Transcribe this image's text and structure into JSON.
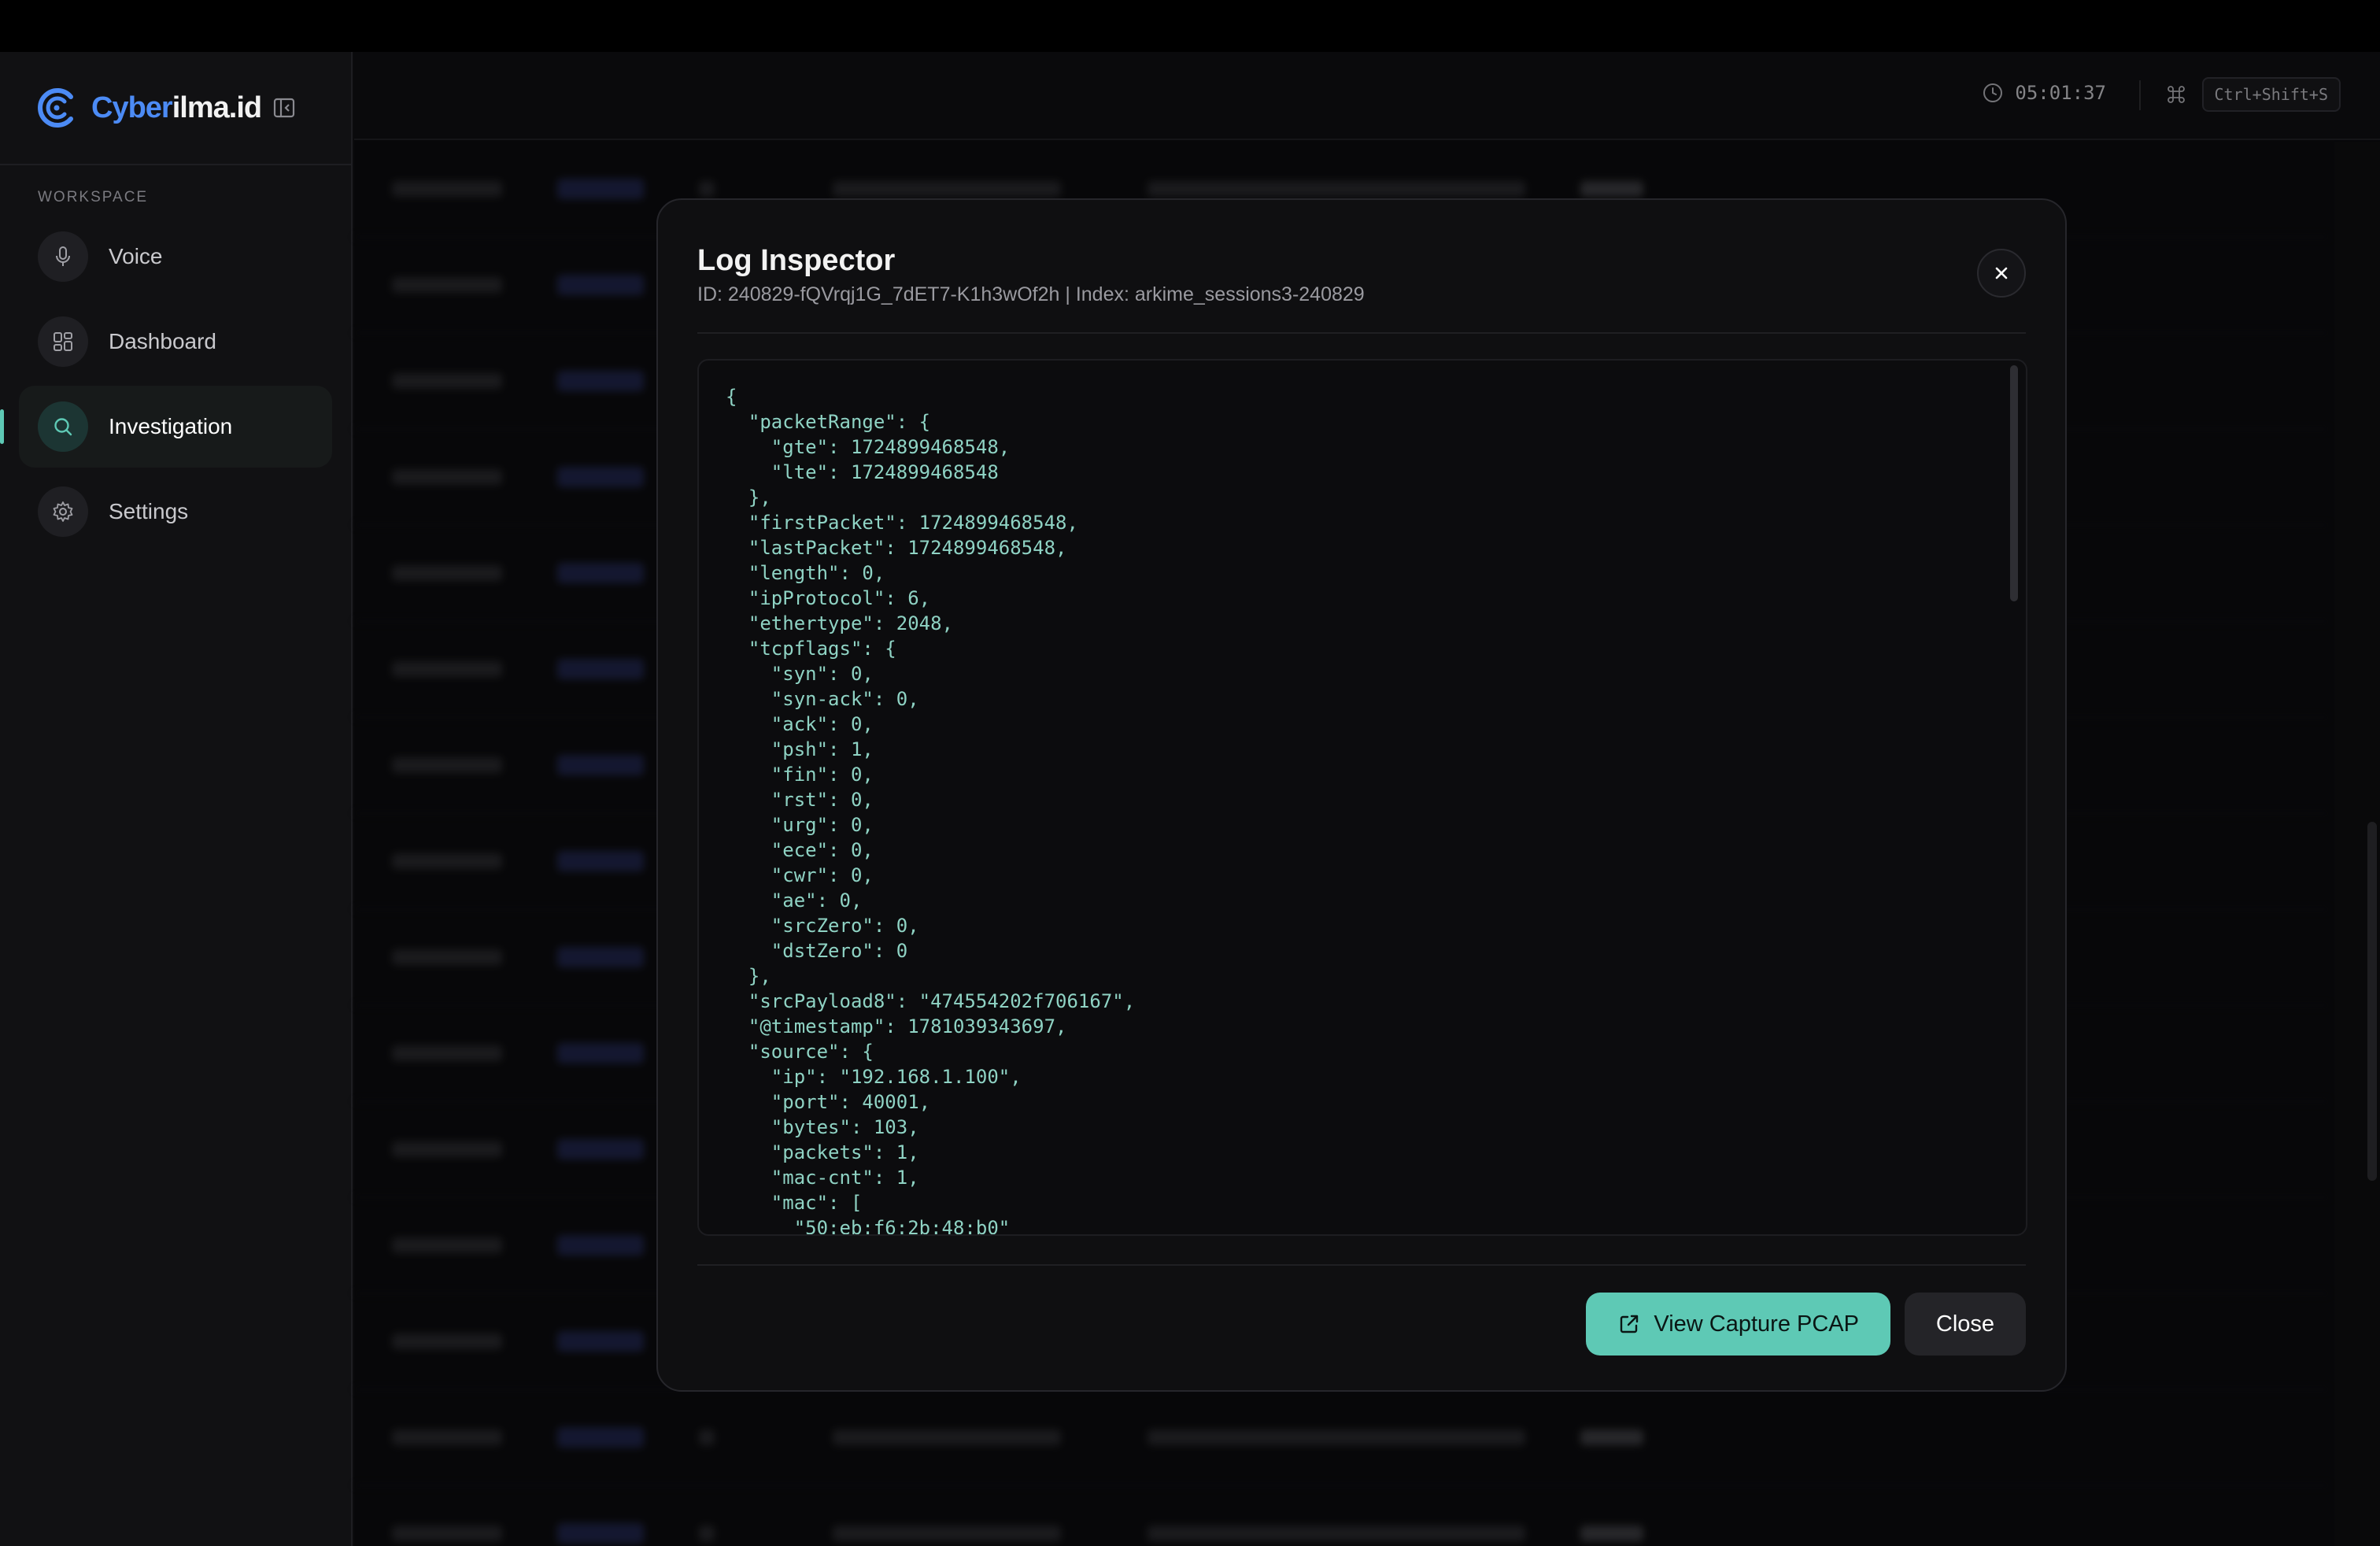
{
  "brand": {
    "name_accent": "Cyber",
    "name_rest": "ilma.id"
  },
  "sidebar": {
    "section_label": "WORKSPACE",
    "items": [
      {
        "label": "Voice",
        "icon": "microphone-icon",
        "active": false
      },
      {
        "label": "Dashboard",
        "icon": "dashboard-grid-icon",
        "active": false
      },
      {
        "label": "Investigation",
        "icon": "search-icon",
        "active": true
      },
      {
        "label": "Settings",
        "icon": "gear-icon",
        "active": false
      }
    ]
  },
  "header": {
    "clock": "05:01:37",
    "shortcut_keys": "Ctrl+Shift+S"
  },
  "modal": {
    "title": "Log Inspector",
    "subtitle": "ID: 240829-fQVrqj1G_7dET7-K1h3wOf2h | Index: arkime_sessions3-240829",
    "json_text": "{\n  \"packetRange\": {\n    \"gte\": 1724899468548,\n    \"lte\": 1724899468548\n  },\n  \"firstPacket\": 1724899468548,\n  \"lastPacket\": 1724899468548,\n  \"length\": 0,\n  \"ipProtocol\": 6,\n  \"ethertype\": 2048,\n  \"tcpflags\": {\n    \"syn\": 0,\n    \"syn-ack\": 0,\n    \"ack\": 0,\n    \"psh\": 1,\n    \"fin\": 0,\n    \"rst\": 0,\n    \"urg\": 0,\n    \"ece\": 0,\n    \"cwr\": 0,\n    \"ae\": 0,\n    \"srcZero\": 0,\n    \"dstZero\": 0\n  },\n  \"srcPayload8\": \"474554202f706167\",\n  \"@timestamp\": 1781039343697,\n  \"source\": {\n    \"ip\": \"192.168.1.100\",\n    \"port\": 40001,\n    \"bytes\": 103,\n    \"packets\": 1,\n    \"mac-cnt\": 1,\n    \"mac\": [\n      \"50:eb:f6:2b:48:b0\"",
    "view_pcap_label": "View Capture PCAP",
    "close_label": "Close"
  },
  "colors": {
    "accent": "#5ec9b5",
    "brand_blue": "#4c8bf5",
    "code_text": "#8fd3c4",
    "background": "#0b0b0d"
  }
}
